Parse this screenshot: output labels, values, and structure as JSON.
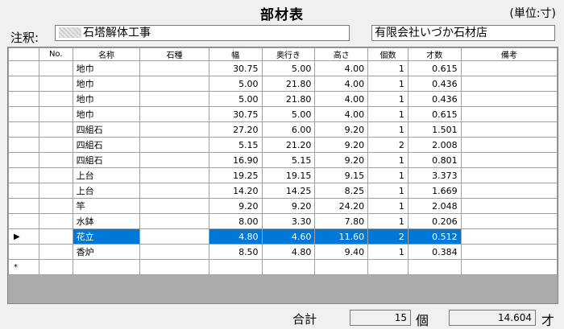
{
  "title": "部材表",
  "unit": "(単位:寸)",
  "note": {
    "label": "注釈:",
    "value": "石塔解体工事"
  },
  "company": "有限会社いづか石材店",
  "table": {
    "headers": [
      "No.",
      "名称",
      "石種",
      "幅",
      "奥行き",
      "高さ",
      "個数",
      "才数",
      "備考"
    ],
    "rows": [
      {
        "no": "",
        "name": "地巾",
        "stone": "",
        "w": "30.75",
        "d": "5.00",
        "h": "4.00",
        "qty": "1",
        "sai": "0.615",
        "note": ""
      },
      {
        "no": "",
        "name": "地巾",
        "stone": "",
        "w": "5.00",
        "d": "21.80",
        "h": "4.00",
        "qty": "1",
        "sai": "0.436",
        "note": ""
      },
      {
        "no": "",
        "name": "地巾",
        "stone": "",
        "w": "5.00",
        "d": "21.80",
        "h": "4.00",
        "qty": "1",
        "sai": "0.436",
        "note": ""
      },
      {
        "no": "",
        "name": "地巾",
        "stone": "",
        "w": "30.75",
        "d": "5.00",
        "h": "4.00",
        "qty": "1",
        "sai": "0.615",
        "note": ""
      },
      {
        "no": "",
        "name": "四組石",
        "stone": "",
        "w": "27.20",
        "d": "6.00",
        "h": "9.20",
        "qty": "1",
        "sai": "1.501",
        "note": ""
      },
      {
        "no": "",
        "name": "四組石",
        "stone": "",
        "w": "5.15",
        "d": "21.20",
        "h": "9.20",
        "qty": "2",
        "sai": "2.008",
        "note": ""
      },
      {
        "no": "",
        "name": "四組石",
        "stone": "",
        "w": "16.90",
        "d": "5.15",
        "h": "9.20",
        "qty": "1",
        "sai": "0.801",
        "note": ""
      },
      {
        "no": "",
        "name": "上台",
        "stone": "",
        "w": "19.25",
        "d": "19.15",
        "h": "9.15",
        "qty": "1",
        "sai": "3.373",
        "note": ""
      },
      {
        "no": "",
        "name": "上台",
        "stone": "",
        "w": "14.20",
        "d": "14.25",
        "h": "8.25",
        "qty": "1",
        "sai": "1.669",
        "note": ""
      },
      {
        "no": "",
        "name": "竿",
        "stone": "",
        "w": "9.20",
        "d": "9.20",
        "h": "24.20",
        "qty": "1",
        "sai": "2.048",
        "note": ""
      },
      {
        "no": "",
        "name": "水鉢",
        "stone": "",
        "w": "8.00",
        "d": "3.30",
        "h": "7.80",
        "qty": "1",
        "sai": "0.206",
        "note": ""
      },
      {
        "no": "",
        "name": "花立",
        "stone": "",
        "w": "4.80",
        "d": "4.60",
        "h": "11.60",
        "qty": "2",
        "sai": "0.512",
        "note": "",
        "selected": true
      },
      {
        "no": "",
        "name": "香炉",
        "stone": "",
        "w": "8.50",
        "d": "4.80",
        "h": "9.40",
        "qty": "1",
        "sai": "0.384",
        "note": ""
      }
    ],
    "current_row_marker": "▶",
    "new_row_marker": "*"
  },
  "footer": {
    "total_label": "合計",
    "count_value": "15",
    "count_unit": "個",
    "total_value": "14.604",
    "total_unit": "才"
  },
  "colors": {
    "selection": "#0078d7",
    "grid_bg": "#ababab",
    "window_bg": "#f0f0f0"
  }
}
